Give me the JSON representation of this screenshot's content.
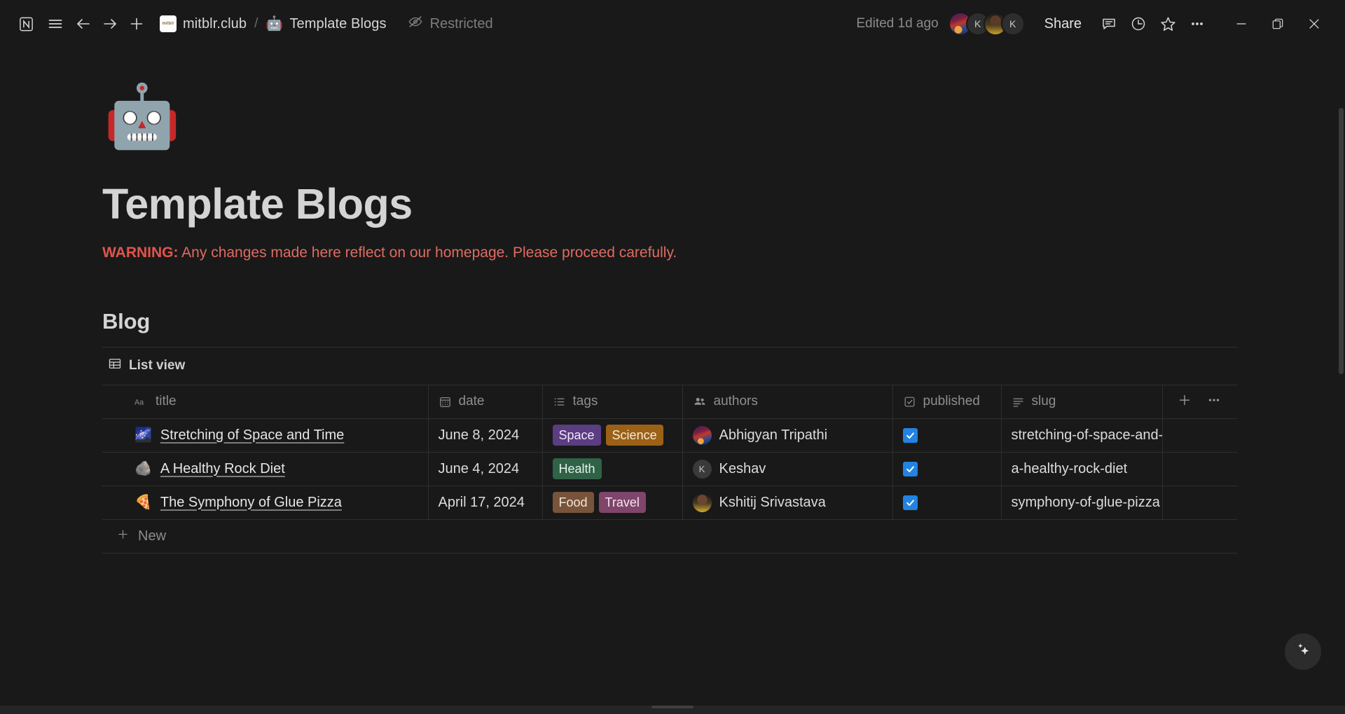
{
  "topbar": {
    "app_icon": "notion-logo-icon",
    "menu_icon": "hamburger-menu-icon",
    "back_icon": "arrow-left-icon",
    "forward_icon": "arrow-right-icon",
    "new_icon": "plus-icon",
    "breadcrumb": {
      "workspace": "mitblr.club",
      "separator": "/",
      "page": "Template Blogs",
      "page_emoji": "🤖"
    },
    "restricted_label": "Restricted",
    "restricted_icon": "eye-off-icon",
    "edited_label": "Edited 1d ago",
    "share_label": "Share",
    "avatars": [
      "",
      "K",
      "",
      "K"
    ],
    "comment_icon": "comment-icon",
    "history_icon": "clock-icon",
    "favorite_icon": "star-icon",
    "more_icon": "ellipsis-icon",
    "minimize_icon": "minimize-icon",
    "maximize_icon": "restore-icon",
    "close_icon": "close-icon"
  },
  "page": {
    "emoji": "🤖",
    "title": "Template Blogs",
    "warning_bold": "WARNING:",
    "warning_rest": " Any changes made here reflect on our homepage. Please proceed carefully.",
    "warning_color": "#e06b62",
    "section_title": "Blog",
    "view_tab": "List view",
    "view_tab_icon": "table-view-icon",
    "new_row_label": "New",
    "new_row_icon": "plus-icon",
    "ai_button_icon": "sparkle-icon"
  },
  "table": {
    "columns": [
      {
        "label": "title",
        "icon": "text-aa-icon"
      },
      {
        "label": "date",
        "icon": "calendar-icon"
      },
      {
        "label": "tags",
        "icon": "multi-select-icon"
      },
      {
        "label": "authors",
        "icon": "person-icon"
      },
      {
        "label": "published",
        "icon": "checkbox-icon"
      },
      {
        "label": "slug",
        "icon": "text-lines-icon"
      }
    ],
    "add_column_icon": "plus-icon",
    "more_options_icon": "ellipsis-icon",
    "rows": [
      {
        "emoji": "🌌",
        "title": "Stretching of Space and Time",
        "date": "June 8, 2024",
        "tags": [
          {
            "label": "Space",
            "bg": "#5b3d82",
            "fg": "#efe7f8"
          },
          {
            "label": "Science",
            "bg": "#9b6116",
            "fg": "#f7ead7"
          }
        ],
        "author": "Abhigyan Tripathi",
        "author_avatar": "photo",
        "published": true,
        "slug": "stretching-of-space-and-time"
      },
      {
        "emoji": "🪨",
        "title": "A Healthy Rock Diet",
        "date": "June 4, 2024",
        "tags": [
          {
            "label": "Health",
            "bg": "#2f6246",
            "fg": "#e4f3ea"
          }
        ],
        "author": "Keshav",
        "author_avatar": "K",
        "published": true,
        "slug": "a-healthy-rock-diet"
      },
      {
        "emoji": "🍕",
        "title": "The Symphony of Glue Pizza",
        "date": "April 17, 2024",
        "tags": [
          {
            "label": "Food",
            "bg": "#77543a",
            "fg": "#f2e6dc"
          },
          {
            "label": "Travel",
            "bg": "#80456b",
            "fg": "#f7e4f1"
          }
        ],
        "author": "Kshitij Srivastava",
        "author_avatar": "photo",
        "published": true,
        "slug": "symphony-of-glue-pizza"
      }
    ]
  },
  "colors": {
    "background": "#191919",
    "accent_blue": "#2383e2",
    "border": "#2f2f2f",
    "text_primary": "#d4d4d4",
    "text_secondary": "#8e8e8e"
  }
}
